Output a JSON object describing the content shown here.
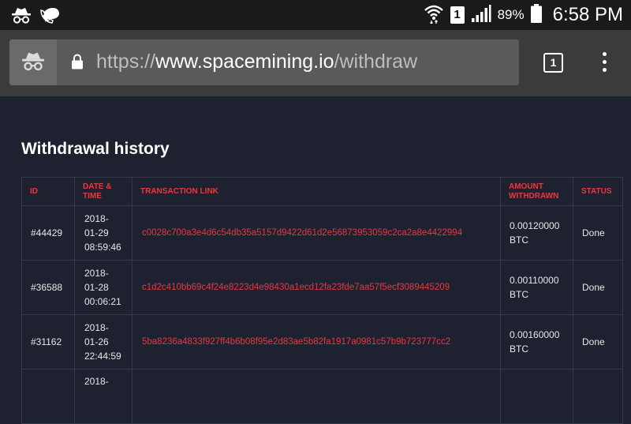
{
  "status_bar": {
    "icons_left": [
      "incognito-icon",
      "missed-call-icon"
    ],
    "icons_right": [
      "wifi-icon",
      "sim-icon",
      "signal-icon",
      "battery-icon"
    ],
    "sim_label": "1",
    "battery_percent": "89%",
    "time": "6:58 PM"
  },
  "browser": {
    "url_scheme": "https://",
    "url_host": "www.spacemining.io",
    "url_path": "/withdraw",
    "tab_count": "1"
  },
  "page": {
    "heading": "Withdrawal history",
    "table": {
      "headers": {
        "id": "ID",
        "date": "DATE & TIME",
        "link": "TRANSACTION LINK",
        "amount": "AMOUNT WITHDRAWN",
        "status": "STATUS"
      },
      "rows": [
        {
          "id": "#44429",
          "date_l1": "2018-",
          "date_l2": "01-29",
          "time": "08:59:46",
          "link": "c0028c700a3e4d6c54db35a5157d9422d61d2e56873953059c2ca2a8e4422994",
          "amount": "0.00120000",
          "unit": "BTC",
          "status": "Done"
        },
        {
          "id": "#36588",
          "date_l1": "2018-",
          "date_l2": "01-28",
          "time": "00:06:21",
          "link": "c1d2c410bb69c4f24e8223d4e98430a1ecd12fa23fde7aa57f5ecf3089445209",
          "amount": "0.00110000",
          "unit": "BTC",
          "status": "Done"
        },
        {
          "id": "#31162",
          "date_l1": "2018-",
          "date_l2": "01-26",
          "time": "22:44:59",
          "link": "5ba8236a4833f927ff4b6b08f95e2d83ae5b82fa1917a0981c57b9b723777cc2",
          "amount": "0.00160000",
          "unit": "BTC",
          "status": "Done"
        },
        {
          "id": "",
          "date_l1": "2018-",
          "date_l2": "",
          "time": "",
          "link": "",
          "amount": "",
          "unit": "",
          "status": ""
        }
      ]
    }
  },
  "colors": {
    "page_bg": "#1d2130",
    "accent_red": "#e8393f",
    "toolbar_bg": "#3b3b3b",
    "statusbar_bg": "#1a1a1a"
  }
}
